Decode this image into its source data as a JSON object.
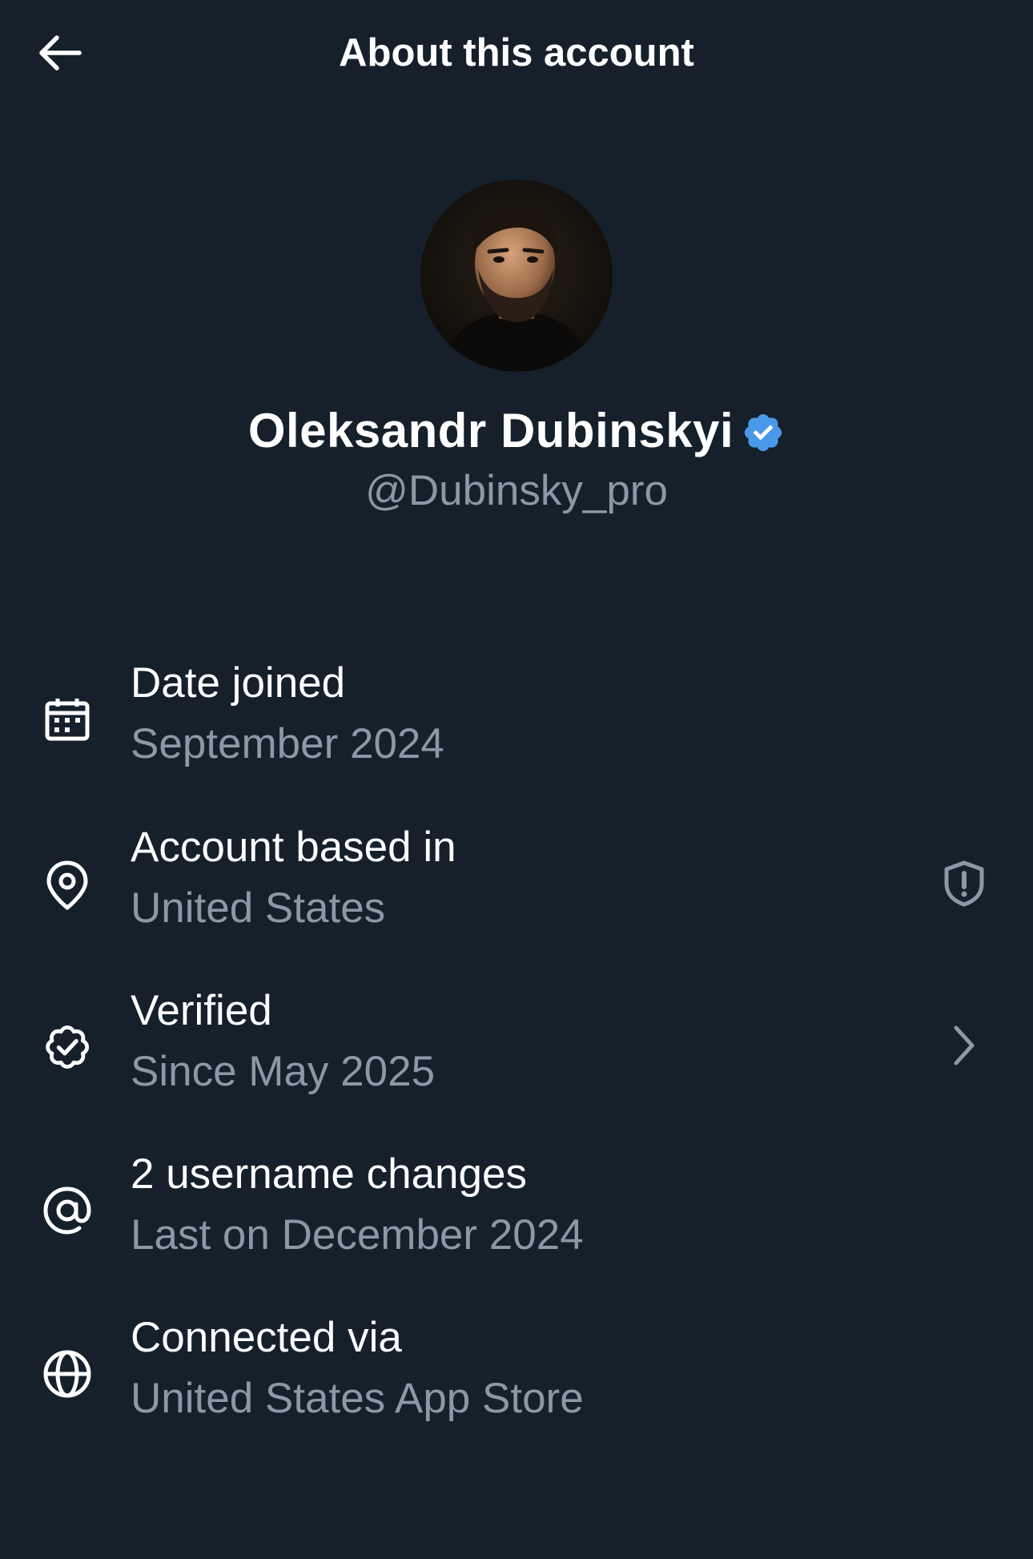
{
  "header": {
    "title": "About this account",
    "back_icon": "arrow-left-icon"
  },
  "profile": {
    "display_name": "Oleksandr Dubinskyi",
    "handle": "@Dubinsky_pro",
    "verified": true,
    "badge_color": "#4a99e9"
  },
  "colors": {
    "background": "#15202b",
    "primary_text": "#ffffff",
    "secondary_text": "#8b98a5"
  },
  "rows": [
    {
      "icon": "calendar-icon",
      "label": "Date joined",
      "value": "September 2024"
    },
    {
      "icon": "location-pin-icon",
      "label": "Account based in",
      "value": "United States",
      "right_icon": "shield-alert-icon"
    },
    {
      "icon": "verified-check-icon",
      "label": "Verified",
      "value": "Since May 2025",
      "right_icon": "chevron-right-icon"
    },
    {
      "icon": "at-sign-icon",
      "label": "2 username changes",
      "value": "Last on December 2024"
    },
    {
      "icon": "globe-icon",
      "label": "Connected via",
      "value": "United States App Store"
    }
  ]
}
